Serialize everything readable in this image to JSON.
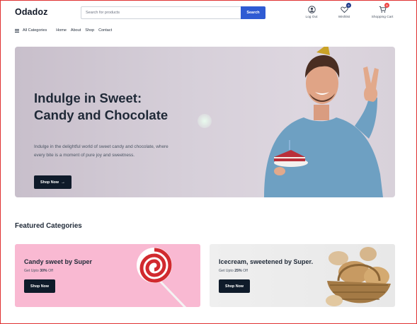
{
  "header": {
    "logo": "Odadoz",
    "search": {
      "placeholder": "Search for products",
      "button": "Search"
    },
    "actions": [
      {
        "label": "Log Out",
        "icon": "user-icon"
      },
      {
        "label": "Wishlist",
        "icon": "heart-icon",
        "badge": "0"
      },
      {
        "label": "Shopping Cart",
        "icon": "cart-icon",
        "badge": "0"
      }
    ]
  },
  "nav": {
    "all_categories": "All Categories",
    "links": [
      "Home",
      "About",
      "Shop",
      "Contact"
    ]
  },
  "hero": {
    "title": "Indulge in Sweet: Candy and Chocolate",
    "subtitle": "Indulge in the delightful world of sweet candy and chocolate, where every bite is a moment of pure joy and sweetness.",
    "button": "Shop Now"
  },
  "featured": {
    "title": "Featured Categories",
    "cards": [
      {
        "title": "Candy sweet by Super",
        "sub_prefix": "Get Upto",
        "discount": "30%",
        "sub_suffix": "Off",
        "button": "Shop Now"
      },
      {
        "title": "Icecream, sweetened by Super.",
        "sub_prefix": "Get Upto",
        "discount": "25%",
        "sub_suffix": "Off",
        "button": "Shop Now"
      }
    ]
  },
  "colors": {
    "primary": "#2f5bd3",
    "dark": "#0f1b2a",
    "badge_blue": "#1e3a8a",
    "badge_red": "#ef4444",
    "card_pink": "#f9b9d2"
  }
}
